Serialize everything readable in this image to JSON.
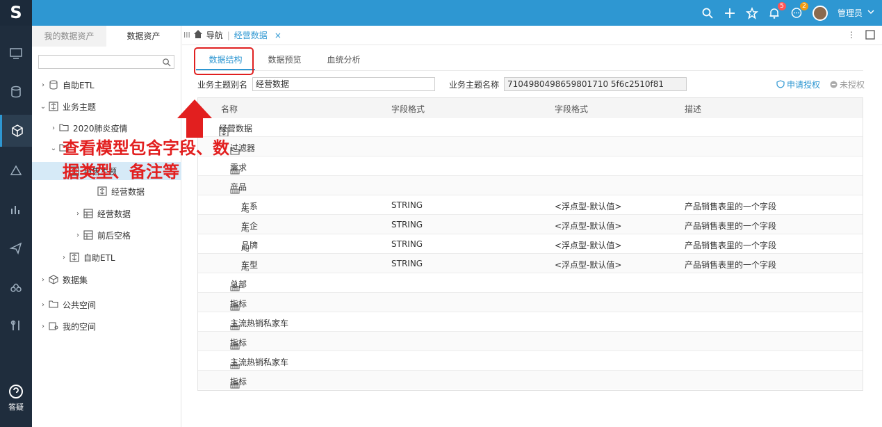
{
  "app": {
    "logo": "S",
    "user_name": "管理员",
    "bell_count": "5",
    "msg_count": "2"
  },
  "leftbar": {
    "help_label": "答疑"
  },
  "panel": {
    "tabs": [
      "我的数据资产",
      "数据资产"
    ],
    "tree": [
      {
        "label": "自助ETL",
        "arrow": "›",
        "icon": "etl-icon"
      },
      {
        "label": "业务主题",
        "arrow": "⌄",
        "icon": "topic-icon"
      },
      {
        "label": "2020肺炎疫情",
        "arrow": "›",
        "icon": "folder-icon"
      },
      {
        "label": "",
        "arrow": "⌄",
        "icon": "folder-icon"
      },
      {
        "label": "销售主题",
        "arrow": "⌄",
        "icon": "topic-icon"
      },
      {
        "label": "经营数据",
        "arrow": "",
        "icon": "topic-icon"
      },
      {
        "label": "经营数据",
        "arrow": "›",
        "icon": "table-icon"
      },
      {
        "label": "前后空格",
        "arrow": "›",
        "icon": "table-icon"
      },
      {
        "label": "自助ETL",
        "arrow": "›",
        "icon": "topic-icon"
      },
      {
        "label": "数据集",
        "arrow": "›",
        "icon": "cube-icon"
      },
      {
        "label": "公共空间",
        "arrow": "›",
        "icon": "folder-icon"
      },
      {
        "label": "我的空间",
        "arrow": "›",
        "icon": "my-space-icon"
      }
    ]
  },
  "main": {
    "nav": {
      "nav_label": "导航",
      "tab_label": "经营数据",
      "close": "×"
    },
    "subtabs": [
      "数据结构",
      "数据预览",
      "血统分析"
    ],
    "form": {
      "alias_label": "业务主题别名",
      "alias_value": "经营数据",
      "name_label": "业务主题名称",
      "name_value": "7104980498659801710 5f6c2510f81",
      "apply_label": "申请授权",
      "status_label": "未授权"
    },
    "grid": {
      "headers": [
        "名称",
        "字段格式",
        "字段格式",
        "描述"
      ],
      "rows": [
        {
          "indent": 0,
          "icon": "topic-icon",
          "name": "经营数据",
          "type": "",
          "fmt": "",
          "desc": ""
        },
        {
          "indent": 1,
          "icon": "folder-icon",
          "name": "过滤器",
          "type": "",
          "fmt": "",
          "desc": ""
        },
        {
          "indent": 1,
          "icon": "dimension-icon",
          "name": "需求",
          "type": "",
          "fmt": "",
          "desc": ""
        },
        {
          "indent": 1,
          "icon": "dimension-icon",
          "name": "产品",
          "type": "",
          "fmt": "",
          "desc": ""
        },
        {
          "indent": 2,
          "icon": "text-field-icon",
          "name": "车系",
          "type": "STRING",
          "fmt": "<浮点型-默认值>",
          "desc": "产品销售表里的一个字段"
        },
        {
          "indent": 2,
          "icon": "text-field-icon",
          "name": "车企",
          "type": "STRING",
          "fmt": "<浮点型-默认值>",
          "desc": "产品销售表里的一个字段"
        },
        {
          "indent": 2,
          "icon": "text-field-icon",
          "name": "品牌",
          "type": "STRING",
          "fmt": "<浮点型-默认值>",
          "desc": "产品销售表里的一个字段"
        },
        {
          "indent": 2,
          "icon": "text-field-icon",
          "name": "车型",
          "type": "STRING",
          "fmt": "<浮点型-默认值>",
          "desc": "产品销售表里的一个字段"
        },
        {
          "indent": 1,
          "icon": "dimension-icon",
          "name": "总部",
          "type": "",
          "fmt": "",
          "desc": ""
        },
        {
          "indent": 1,
          "icon": "dimension-icon",
          "name": "指标",
          "type": "",
          "fmt": "",
          "desc": ""
        },
        {
          "indent": 1,
          "icon": "dimension-icon",
          "name": "主流热销私家车",
          "type": "",
          "fmt": "",
          "desc": ""
        },
        {
          "indent": 1,
          "icon": "dimension-icon",
          "name": "指标",
          "type": "",
          "fmt": "",
          "desc": ""
        },
        {
          "indent": 1,
          "icon": "dimension-icon",
          "name": "主流热销私家车",
          "type": "",
          "fmt": "",
          "desc": ""
        },
        {
          "indent": 1,
          "icon": "dimension-icon",
          "name": "指标",
          "type": "",
          "fmt": "",
          "desc": ""
        }
      ]
    }
  },
  "annotation": {
    "text": "查看模型包含字段、数据类型、备注等",
    "color": "#e21f1f"
  },
  "colors": {
    "accent": "#2e97d2",
    "sidebar": "#1f2d3d",
    "highlight": "#e02020"
  }
}
